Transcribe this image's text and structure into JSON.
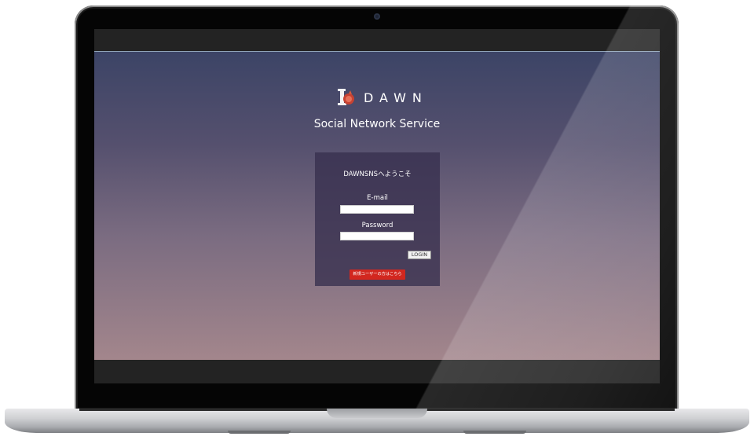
{
  "app": {
    "brand_name": "DAWN",
    "tagline": "Social Network Service",
    "logo_icon": "dawn-logo-icon"
  },
  "login": {
    "welcome_text": "DAWNSNSへようこそ",
    "email_label": "E-mail",
    "email_value": "",
    "password_label": "Password",
    "password_value": "",
    "login_button": "LOGIN",
    "register_button": "新規ユーザーの方はこちら"
  },
  "colors": {
    "register_button": "#d2271f",
    "gradient_top": "#3c4466",
    "gradient_bottom": "#a3868c"
  }
}
